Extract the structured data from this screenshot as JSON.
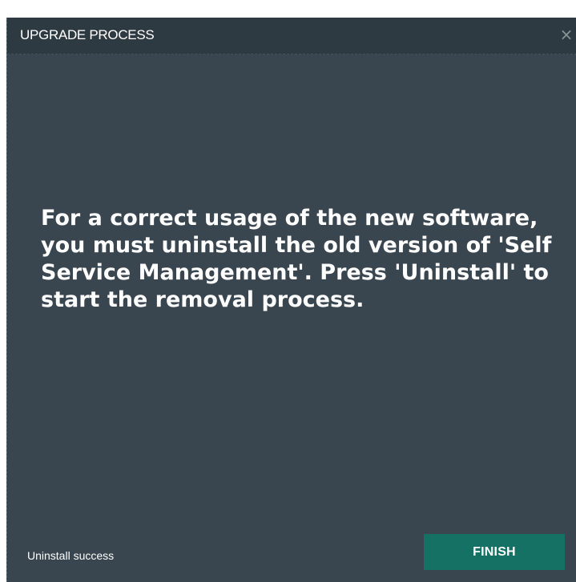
{
  "dialog": {
    "title": "UPGRADE PROCESS",
    "close_glyph": "×",
    "message": "For a correct usage of the new software, you must uninstall the old version of 'Self Service Management'. Press 'Uninstall' to start the removal process.",
    "status": "Uninstall success",
    "finish_label": "FINISH"
  },
  "colors": {
    "body_bg": "#39464f",
    "titlebar_bg": "#2e3a41",
    "button_bg": "#157164",
    "text": "#ffffff"
  },
  "icons": {
    "close": "close-icon"
  }
}
